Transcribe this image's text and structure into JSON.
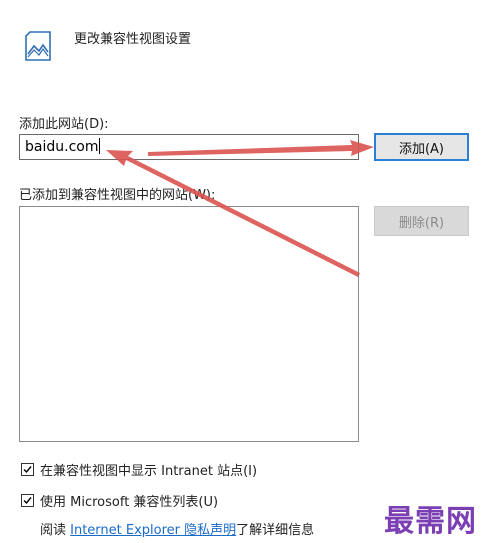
{
  "header": {
    "title": "更改兼容性视图设置",
    "icon": "site-picture-icon"
  },
  "add_site": {
    "label": "添加此网站(D):",
    "value": "baidu.com",
    "button_label": "添加(A)"
  },
  "added_sites": {
    "label": "已添加到兼容性视图中的网站(W):",
    "items": [],
    "remove_label": "删除(R)"
  },
  "options": [
    {
      "label": "在兼容性视图中显示 Intranet 站点(I)",
      "checked": true
    },
    {
      "label": "使用 Microsoft 兼容性列表(U)",
      "checked": true
    }
  ],
  "privacy": {
    "prefix": "阅读 ",
    "link_text": "Internet Explorer 隐私声明",
    "suffix": "了解详细信息"
  },
  "watermark": "最需网",
  "colors": {
    "accent": "#2a7fd6",
    "annotation_arrow": "#d9534f",
    "watermark": "#7b3fb3",
    "link": "#1a6ac8"
  }
}
